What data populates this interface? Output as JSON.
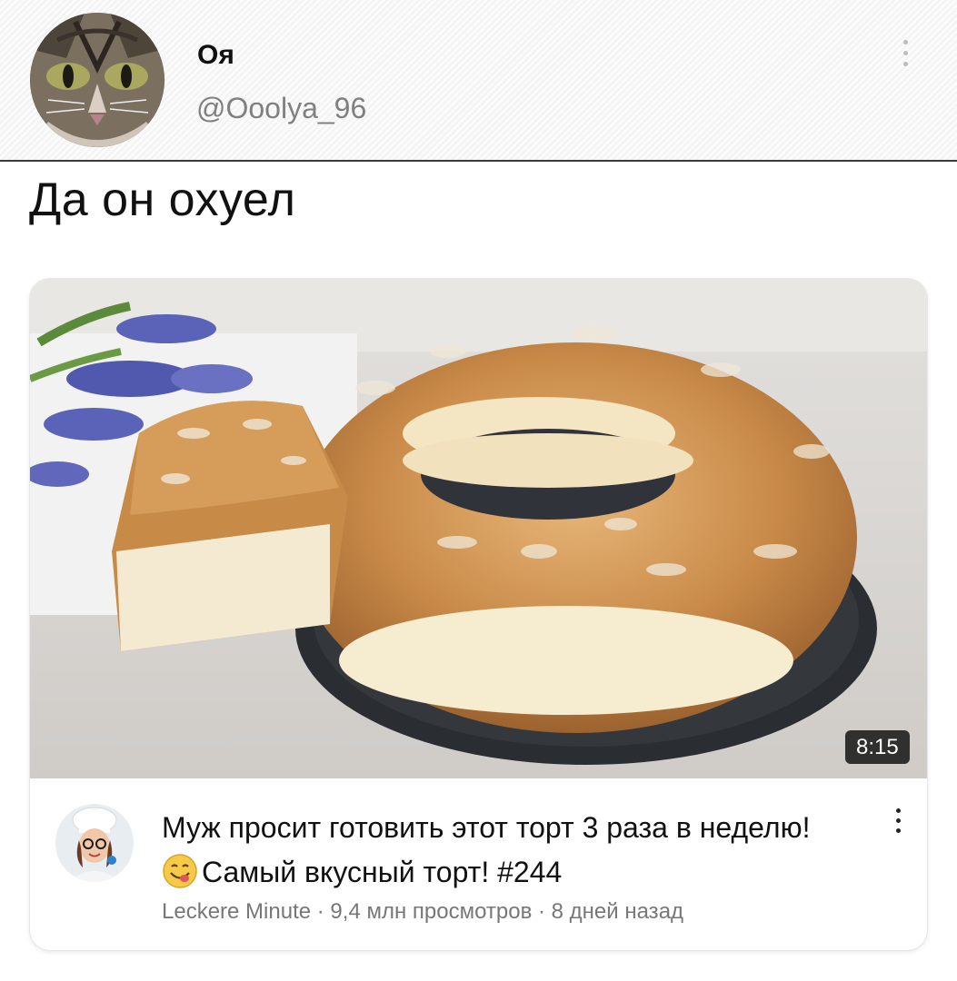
{
  "tweet": {
    "author_name": "Оя",
    "author_handle": "@Ooolya_96",
    "text": "Да он охуел"
  },
  "video": {
    "duration": "8:15",
    "title_part1": "Муж просит готовить этот торт 3 раза в неделю! ",
    "title_part2": "Самый вкусный торт! #244",
    "emoji": "yum-face-emoji",
    "channel": "Leckere Minute",
    "views": "9,4 млн просмотров",
    "age": "8 дней назад",
    "separator": " · "
  },
  "icons": {
    "more_tweet": "more-vertical-icon",
    "more_video": "more-vertical-icon"
  },
  "colors": {
    "handle_gray": "#808080",
    "meta_gray": "#777777",
    "duration_bg": "#141414",
    "emoji_yellow": "#f7c948"
  }
}
